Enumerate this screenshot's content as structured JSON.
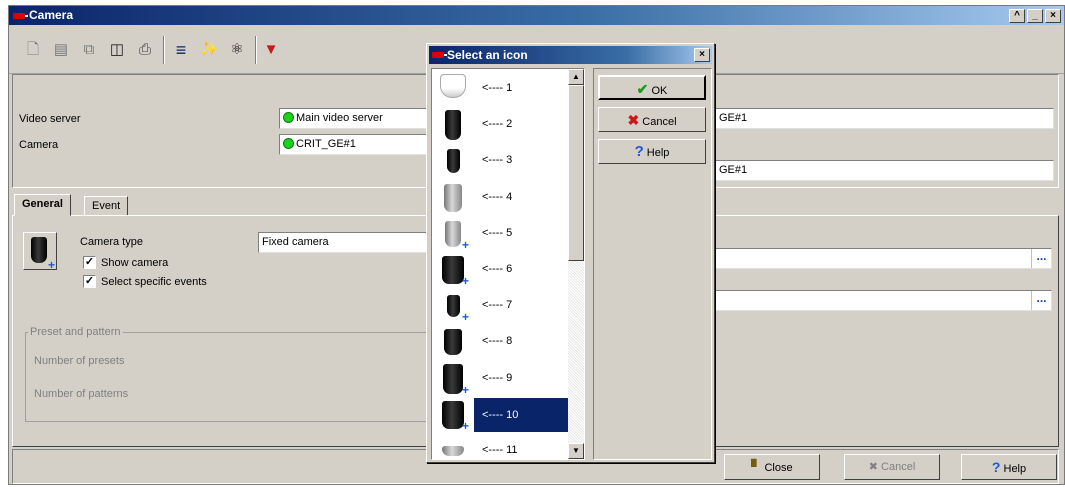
{
  "window": {
    "title": "Camera"
  },
  "toolbar": {
    "icons": [
      "new-icon",
      "save-icon",
      "copy-icon",
      "delete-icon",
      "print-icon",
      "list-icon",
      "link-icon",
      "find-icon",
      "pin-icon"
    ]
  },
  "form": {
    "video_server_label": "Video server",
    "video_server_value": "Main video server",
    "camera_label": "Camera",
    "camera_value": "CRIT_GE#1",
    "right_field_1": "GE#1",
    "right_field_2": "GE#1"
  },
  "tabs": [
    {
      "label": "General"
    },
    {
      "label": "Event"
    }
  ],
  "general": {
    "camera_type_label": "Camera type",
    "camera_type_value": "Fixed camera",
    "show_camera_label": "Show camera",
    "show_camera_checked": true,
    "select_events_label": "Select specific events",
    "select_events_checked": true,
    "preset_group_label": "Preset and pattern",
    "presets_label": "Number of presets",
    "patterns_label": "Number of patterns",
    "browse_label": "..."
  },
  "footer": {
    "close_label": "Close",
    "cancel_label": "Cancel",
    "help_label": "Help"
  },
  "dialog": {
    "title": "Select an icon",
    "close_glyph": "×",
    "icons": [
      {
        "label": "<---- 1"
      },
      {
        "label": "<---- 2"
      },
      {
        "label": "<---- 3"
      },
      {
        "label": "<---- 4"
      },
      {
        "label": "<---- 5"
      },
      {
        "label": "<---- 6"
      },
      {
        "label": "<---- 7"
      },
      {
        "label": "<---- 8"
      },
      {
        "label": "<---- 9"
      },
      {
        "label": "<---- 10"
      },
      {
        "label": "<---- 11"
      }
    ],
    "selected_index": 9,
    "ok_label": "OK",
    "cancel_label": "Cancel",
    "help_label": "Help"
  },
  "colors": {
    "title_bar": "#0a246a",
    "selection": "#0a246a",
    "status_green": "#1bd31b",
    "ok_check": "#1a9a1a",
    "cancel_x": "#c81a1a",
    "help": "#1a5ad8"
  }
}
